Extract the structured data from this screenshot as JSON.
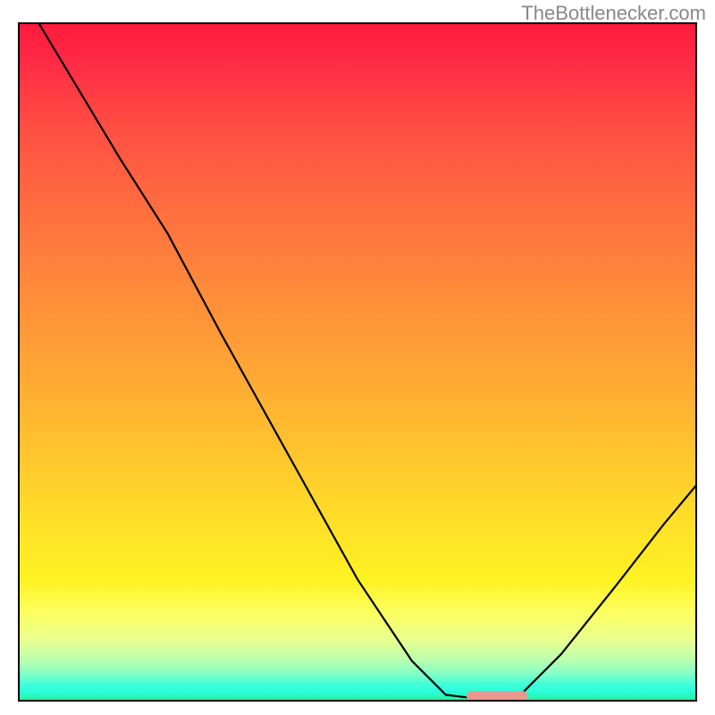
{
  "watermark": "TheBottlenecker.com",
  "chart_data": {
    "type": "line",
    "title": "",
    "xlabel": "",
    "ylabel": "",
    "x_range": [
      0,
      100
    ],
    "y_range": [
      0,
      100
    ],
    "curve_points": [
      {
        "x": 3,
        "y": 100
      },
      {
        "x": 15,
        "y": 80
      },
      {
        "x": 22,
        "y": 69
      },
      {
        "x": 30,
        "y": 54
      },
      {
        "x": 40,
        "y": 36
      },
      {
        "x": 50,
        "y": 18
      },
      {
        "x": 58,
        "y": 6
      },
      {
        "x": 63,
        "y": 1
      },
      {
        "x": 67,
        "y": 0.5
      },
      {
        "x": 74,
        "y": 1
      },
      {
        "x": 80,
        "y": 7
      },
      {
        "x": 88,
        "y": 17
      },
      {
        "x": 95,
        "y": 26
      },
      {
        "x": 100,
        "y": 32
      }
    ],
    "marker": {
      "x_start": 66,
      "x_end": 75,
      "y": 0.8,
      "color": "#e8998c"
    },
    "gradient_colors": {
      "top": "#ff1a3a",
      "middle": "#ffc42e",
      "bottom": "#28ee90"
    }
  }
}
